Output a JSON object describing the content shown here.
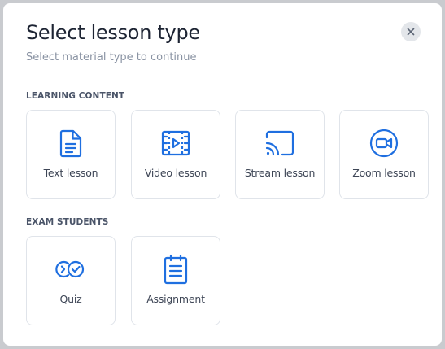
{
  "dialog": {
    "title": "Select lesson type",
    "subtitle": "Select material type to continue",
    "close_icon": "close-icon"
  },
  "sections": [
    {
      "label": "LEARNING CONTENT",
      "items": [
        {
          "label": "Text lesson",
          "icon": "document-icon"
        },
        {
          "label": "Video lesson",
          "icon": "video-icon"
        },
        {
          "label": "Stream lesson",
          "icon": "cast-icon"
        },
        {
          "label": "Zoom lesson",
          "icon": "zoom-camera-icon"
        }
      ]
    },
    {
      "label": "EXAM STUDENTS",
      "items": [
        {
          "label": "Quiz",
          "icon": "quiz-icon"
        },
        {
          "label": "Assignment",
          "icon": "clipboard-icon"
        }
      ]
    }
  ],
  "colors": {
    "accent": "#1f6fe0",
    "overlay": "#c9cbcf",
    "card_border": "#e0e4ea"
  }
}
